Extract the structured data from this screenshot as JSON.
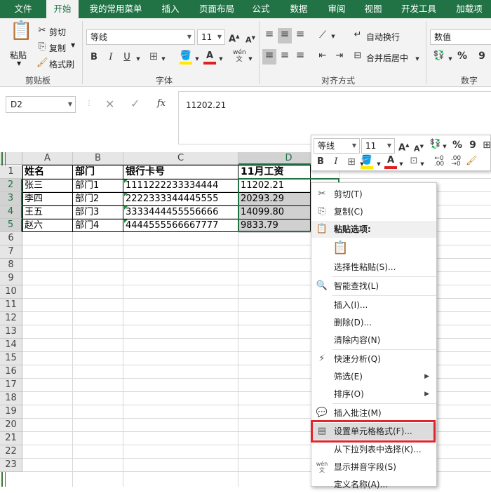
{
  "tabs": [
    "文件",
    "开始",
    "我的常用菜单",
    "插入",
    "页面布局",
    "公式",
    "数据",
    "审阅",
    "视图",
    "开发工具",
    "加载项"
  ],
  "active_tab": "开始",
  "ribbon": {
    "clipboard": {
      "paste": "粘贴",
      "cut": "剪切",
      "copy": "复制",
      "format_painter": "格式刷",
      "label": "剪贴板"
    },
    "font": {
      "name": "等线",
      "size": "11",
      "label": "字体",
      "bold": "B",
      "italic": "I",
      "underline": "U"
    },
    "alignment": {
      "wrap": "自动换行",
      "merge": "合并后居中",
      "label": "对齐方式"
    },
    "number": {
      "format": "数值",
      "percent": "%",
      "comma": "9",
      "label": "数字"
    }
  },
  "formula_bar": {
    "name_box": "D2",
    "fx": "fx",
    "value": "11202.21"
  },
  "columns": [
    "A",
    "B",
    "C",
    "D"
  ],
  "rows": [
    "1",
    "2",
    "3",
    "4",
    "5",
    "6",
    "7",
    "8",
    "9",
    "10",
    "11",
    "12",
    "13",
    "14",
    "15",
    "16",
    "17",
    "18",
    "19",
    "20",
    "21",
    "22",
    "23"
  ],
  "table": {
    "header": [
      "姓名",
      "部门",
      "银行卡号",
      "11月工资"
    ],
    "data": [
      [
        "张三",
        "部门1",
        "1111222233334444",
        "11202.21"
      ],
      [
        "李四",
        "部门2",
        "2222333344445555",
        "20293.29"
      ],
      [
        "王五",
        "部门3",
        "3333444455556666",
        "14099.80"
      ],
      [
        "赵六",
        "部门4",
        "4444555566667777",
        "9833.79"
      ]
    ]
  },
  "mini_toolbar": {
    "font": "等线",
    "size": "11",
    "bold": "B",
    "italic": "I",
    "percent": "%",
    "comma": "9"
  },
  "context_menu": {
    "cut": "剪切(T)",
    "copy": "复制(C)",
    "paste_options": "粘贴选项:",
    "paste_special": "选择性粘贴(S)...",
    "smart_lookup": "智能查找(L)",
    "insert": "插入(I)...",
    "delete": "删除(D)...",
    "clear": "清除内容(N)",
    "quick_analysis": "快速分析(Q)",
    "filter": "筛选(E)",
    "sort": "排序(O)",
    "insert_comment": "插入批注(M)",
    "format_cells": "设置单元格格式(F)...",
    "pick_list": "从下拉列表中选择(K)...",
    "phonetic": "显示拼音字段(S)",
    "define_name": "定义名称(A)..."
  },
  "colors": {
    "excel_green": "#217346",
    "highlight_red": "#e0262d"
  }
}
